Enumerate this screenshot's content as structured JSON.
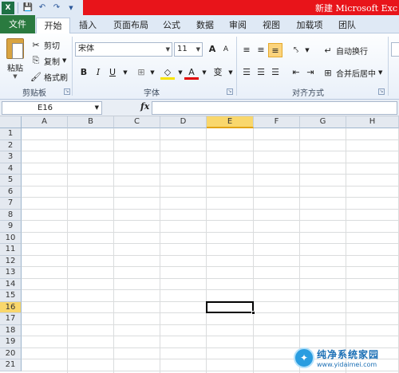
{
  "window": {
    "title": "新建 Microsoft Exc"
  },
  "qat": {
    "save_icon": "save-icon",
    "undo_icon": "undo-icon",
    "redo_icon": "redo-icon"
  },
  "ribbon_tabs": [
    "文件",
    "开始",
    "插入",
    "页面布局",
    "公式",
    "数据",
    "审阅",
    "视图",
    "加载项",
    "团队"
  ],
  "clipboard": {
    "paste": "粘贴",
    "cut": "剪切",
    "copy": "复制",
    "format_painter": "格式刷",
    "group_label": "剪贴板"
  },
  "font": {
    "name": "宋体",
    "size": "11",
    "grow": "A",
    "shrink": "A",
    "bold": "B",
    "italic": "I",
    "underline": "U",
    "phonetic": "变",
    "color_letter": "A",
    "group_label": "字体"
  },
  "alignment": {
    "wrap_text": "自动换行",
    "merge_center": "合并后居中",
    "group_label": "对齐方式"
  },
  "formula_bar": {
    "name_box": "E16",
    "fx": "fx"
  },
  "grid": {
    "columns": [
      "A",
      "B",
      "C",
      "D",
      "E",
      "F",
      "G",
      "H"
    ],
    "rows": [
      "1",
      "2",
      "3",
      "4",
      "5",
      "6",
      "7",
      "8",
      "9",
      "10",
      "11",
      "12",
      "13",
      "14",
      "15",
      "16",
      "17",
      "18",
      "19",
      "20",
      "21"
    ],
    "selected_column": "E",
    "selected_row": "16"
  },
  "watermark": {
    "name": "纯净系统家园",
    "url": "www.yidaimei.com"
  },
  "colors": {
    "file_tab": "#2a7a3f",
    "title_bar": "#e8141a",
    "selection_header": "#f9d76c"
  }
}
